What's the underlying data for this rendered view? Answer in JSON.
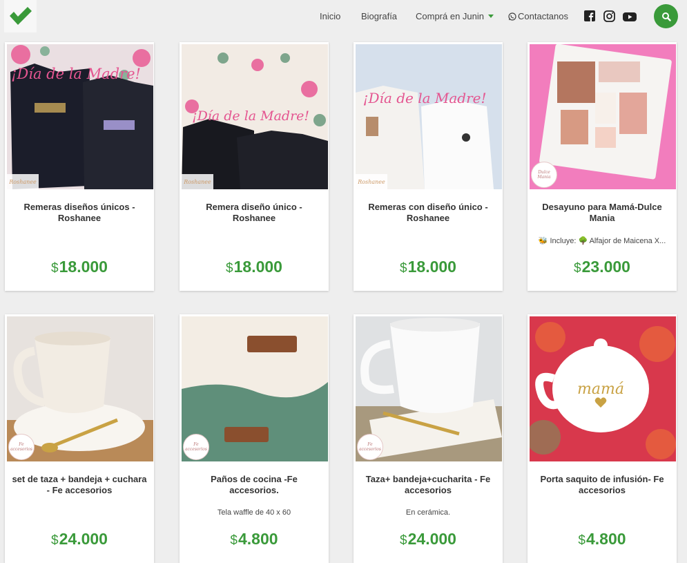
{
  "header": {
    "nav": [
      {
        "label": "Inicio"
      },
      {
        "label": "Biografía"
      },
      {
        "label": "Comprá en Junin"
      },
      {
        "label": "Contactanos"
      }
    ]
  },
  "colors": {
    "accent": "#3a9a3a",
    "background": "#eeeeee"
  },
  "products": [
    {
      "title": "Remeras diseños únicos - Roshanee",
      "description": "",
      "currency": "$",
      "price": "18.000",
      "image_text": "¡Día de la Madre!",
      "brand_badge": "Roshanee"
    },
    {
      "title": "Remera diseño único - Roshanee",
      "description": "",
      "currency": "$",
      "price": "18.000",
      "image_text": "¡Día de la Madre!",
      "brand_badge": "Roshanee"
    },
    {
      "title": "Remeras con diseño único - Roshanee",
      "description": "",
      "currency": "$",
      "price": "18.000",
      "image_text": "¡Día de la Madre!",
      "brand_badge": "Roshanee"
    },
    {
      "title": "Desayuno para Mamá-Dulce Mania",
      "description": "🐝 Incluye: 🌳 Alfajor de Maicena X...",
      "currency": "$",
      "price": "23.000",
      "image_text": "",
      "brand_badge": "Dulce Mania"
    },
    {
      "title": "set de taza + bandeja + cuchara - Fe accesorios",
      "description": "",
      "currency": "$",
      "price": "24.000",
      "image_text": "",
      "brand_badge": "Fe accesorios"
    },
    {
      "title": "Paños de cocina -Fe accesorios.",
      "description": "Tela waffle de 40 x 60",
      "currency": "$",
      "price": "4.800",
      "image_text": "",
      "brand_badge": "Fe accesorios"
    },
    {
      "title": "Taza+ bandeja+cucharita - Fe accesorios",
      "description": "En cerámica.",
      "currency": "$",
      "price": "24.000",
      "image_text": "",
      "brand_badge": "Fe accesorios"
    },
    {
      "title": "Porta saquito de infusión- Fe accesorios",
      "description": "",
      "currency": "$",
      "price": "4.800",
      "image_text": "mamá",
      "brand_badge": ""
    }
  ]
}
